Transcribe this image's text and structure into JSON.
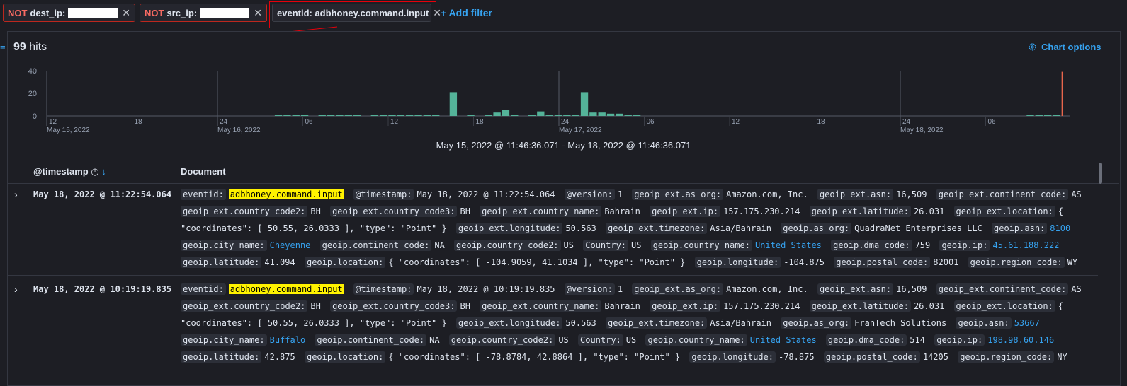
{
  "filters": [
    {
      "not": "NOT",
      "label": "dest_ip:"
    },
    {
      "not": "NOT",
      "label": "src_ip:"
    },
    {
      "label": "eventid: adbhoney.command.input"
    }
  ],
  "add_filter": "+ Add filter",
  "hits": {
    "count": "99",
    "label": "hits"
  },
  "chart_options": "Chart options",
  "time_range": "May 15, 2022 @ 11:46:36.071 - May 18, 2022 @ 11:46:36.071",
  "chart_data": {
    "type": "bar",
    "ylim": [
      0,
      40
    ],
    "yticks": [
      "40",
      "20",
      "0"
    ],
    "xticks": [
      {
        "label": "12",
        "sub": "May 15, 2022"
      },
      {
        "label": "18",
        "sub": ""
      },
      {
        "label": "24",
        "sub": "May 16, 2022"
      },
      {
        "label": "06",
        "sub": ""
      },
      {
        "label": "12",
        "sub": ""
      },
      {
        "label": "18",
        "sub": ""
      },
      {
        "label": "24",
        "sub": "May 17, 2022"
      },
      {
        "label": "06",
        "sub": ""
      },
      {
        "label": "12",
        "sub": ""
      },
      {
        "label": "18",
        "sub": ""
      },
      {
        "label": "24",
        "sub": "May 18, 2022"
      },
      {
        "label": "06",
        "sub": ""
      }
    ],
    "bar_color": "#54b399",
    "values": [
      0,
      0,
      0,
      0,
      0,
      0,
      0,
      0,
      0,
      0,
      0,
      0,
      0,
      0,
      0,
      0,
      0,
      0,
      0,
      0,
      0,
      0,
      0,
      0,
      0,
      0,
      1,
      1,
      1,
      1,
      0,
      1,
      1,
      1,
      1,
      1,
      0,
      1,
      1,
      1,
      1,
      1,
      1,
      1,
      1,
      0,
      21,
      0,
      1,
      0,
      1,
      3,
      5,
      1,
      0,
      1,
      4,
      1,
      1,
      1,
      1,
      21,
      3,
      3,
      2,
      2,
      1,
      1,
      0,
      0,
      0,
      0,
      0,
      0,
      0,
      0,
      0,
      0,
      0,
      0,
      0,
      0,
      0,
      0,
      0,
      0,
      0,
      0,
      0,
      0,
      0,
      0,
      0,
      0,
      0,
      0,
      0,
      0,
      0,
      0,
      0,
      0,
      0,
      0,
      0,
      0,
      0,
      0,
      0,
      0,
      0,
      0,
      1,
      1,
      1,
      1,
      39
    ]
  },
  "columns": {
    "timestamp": "@timestamp",
    "document": "Document"
  },
  "rows": [
    {
      "timestamp": "May 18, 2022 @ 11:22:54.064",
      "fields": [
        [
          "eventid:",
          "adbhoney.command.input",
          "hl"
        ],
        [
          "@timestamp:",
          "May 18, 2022 @ 11:22:54.064",
          ""
        ],
        [
          "@version:",
          "1",
          ""
        ],
        [
          "geoip_ext.as_org:",
          "Amazon.com, Inc.",
          ""
        ],
        [
          "geoip_ext.asn:",
          "16,509",
          ""
        ],
        [
          "geoip_ext.continent_code:",
          "AS",
          ""
        ],
        [
          "geoip_ext.country_code2:",
          "BH",
          ""
        ],
        [
          "geoip_ext.country_code3:",
          "BH",
          ""
        ],
        [
          "geoip_ext.country_name:",
          "Bahrain",
          ""
        ],
        [
          "geoip_ext.ip:",
          "157.175.230.214",
          ""
        ],
        [
          "geoip_ext.latitude:",
          "26.031",
          ""
        ],
        [
          "geoip_ext.location:",
          "{ \"coordinates\": [ 50.55, 26.0333 ], \"type\": \"Point\" }",
          ""
        ],
        [
          "geoip_ext.longitude:",
          "50.563",
          ""
        ],
        [
          "geoip_ext.timezone:",
          "Asia/Bahrain",
          ""
        ],
        [
          "geoip.as_org:",
          "QuadraNet Enterprises LLC",
          ""
        ],
        [
          "geoip.asn:",
          "8100",
          "lnk"
        ],
        [
          "geoip.city_name:",
          "Cheyenne",
          "lnk"
        ],
        [
          "geoip.continent_code:",
          "NA",
          ""
        ],
        [
          "geoip.country_code2:",
          "US",
          ""
        ],
        [
          "Country:",
          "US",
          ""
        ],
        [
          "geoip.country_name:",
          "United States",
          "lnk"
        ],
        [
          "geoip.dma_code:",
          "759",
          ""
        ],
        [
          "geoip.ip:",
          "45.61.188.222",
          "lnk"
        ],
        [
          "geoip.latitude:",
          "41.094",
          ""
        ],
        [
          "geoip.location:",
          "{ \"coordinates\": [ -104.9059, 41.1034 ], \"type\": \"Point\" }",
          ""
        ],
        [
          "geoip.longitude:",
          "-104.875",
          ""
        ],
        [
          "geoip.postal_code:",
          "82001",
          ""
        ],
        [
          "geoip.region_code:",
          "WY",
          ""
        ]
      ]
    },
    {
      "timestamp": "May 18, 2022 @ 10:19:19.835",
      "fields": [
        [
          "eventid:",
          "adbhoney.command.input",
          "hl"
        ],
        [
          "@timestamp:",
          "May 18, 2022 @ 10:19:19.835",
          ""
        ],
        [
          "@version:",
          "1",
          ""
        ],
        [
          "geoip_ext.as_org:",
          "Amazon.com, Inc.",
          ""
        ],
        [
          "geoip_ext.asn:",
          "16,509",
          ""
        ],
        [
          "geoip_ext.continent_code:",
          "AS",
          ""
        ],
        [
          "geoip_ext.country_code2:",
          "BH",
          ""
        ],
        [
          "geoip_ext.country_code3:",
          "BH",
          ""
        ],
        [
          "geoip_ext.country_name:",
          "Bahrain",
          ""
        ],
        [
          "geoip_ext.ip:",
          "157.175.230.214",
          ""
        ],
        [
          "geoip_ext.latitude:",
          "26.031",
          ""
        ],
        [
          "geoip_ext.location:",
          "{ \"coordinates\": [ 50.55, 26.0333 ], \"type\": \"Point\" }",
          ""
        ],
        [
          "geoip_ext.longitude:",
          "50.563",
          ""
        ],
        [
          "geoip_ext.timezone:",
          "Asia/Bahrain",
          ""
        ],
        [
          "geoip.as_org:",
          "FranTech Solutions",
          ""
        ],
        [
          "geoip.asn:",
          "53667",
          "lnk"
        ],
        [
          "geoip.city_name:",
          "Buffalo",
          "lnk"
        ],
        [
          "geoip.continent_code:",
          "NA",
          ""
        ],
        [
          "geoip.country_code2:",
          "US",
          ""
        ],
        [
          "Country:",
          "US",
          ""
        ],
        [
          "geoip.country_name:",
          "United States",
          "lnk"
        ],
        [
          "geoip.dma_code:",
          "514",
          ""
        ],
        [
          "geoip.ip:",
          "198.98.60.146",
          "lnk"
        ],
        [
          "geoip.latitude:",
          "42.875",
          ""
        ],
        [
          "geoip.location:",
          "{ \"coordinates\": [ -78.8784, 42.8864 ], \"type\": \"Point\" }",
          ""
        ],
        [
          "geoip.longitude:",
          "-78.875",
          ""
        ],
        [
          "geoip.postal_code:",
          "14205",
          ""
        ],
        [
          "geoip.region_code:",
          "NY",
          ""
        ]
      ]
    }
  ],
  "icons": {
    "sort": "clock-icon",
    "sort_dir": "arrow-down-icon",
    "expand": "chevron-right-icon",
    "remove": "close-icon",
    "gear": "gear-icon"
  }
}
